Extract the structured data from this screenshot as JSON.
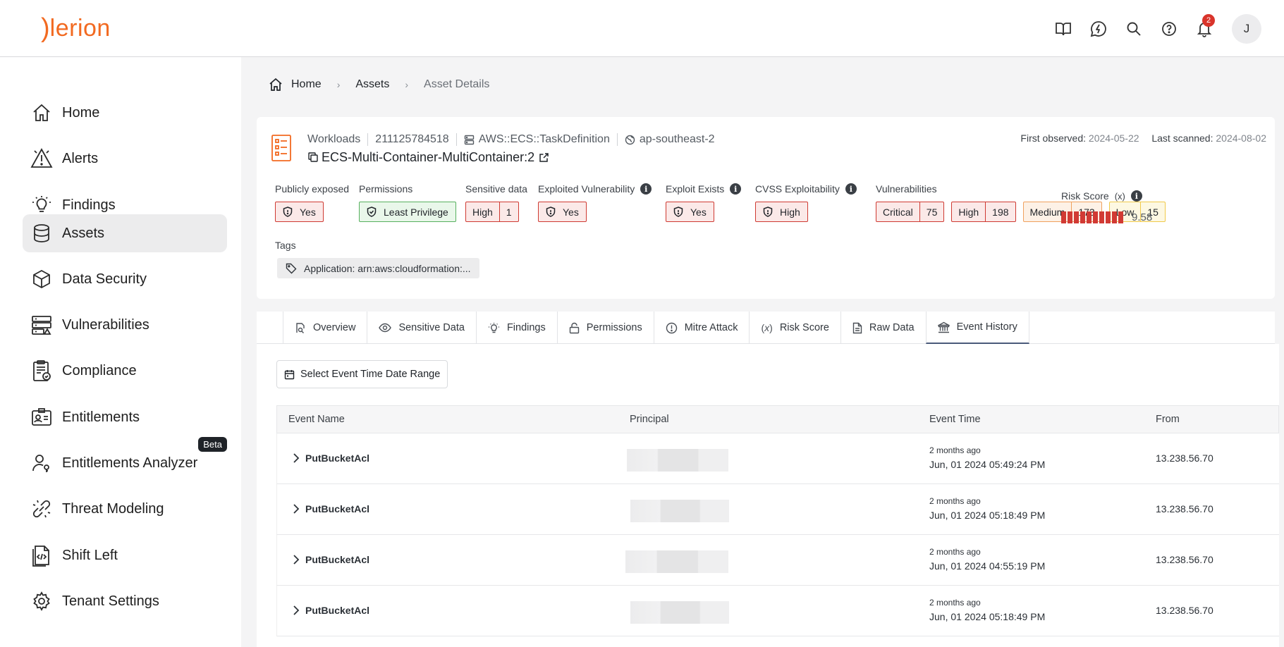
{
  "brand": {
    "logo_mark": ")",
    "logo_text": "lerion",
    "accent": "#f26a21"
  },
  "header": {
    "notification_count": "2",
    "avatar_initial": "J"
  },
  "sidebar": {
    "items": [
      {
        "label": "Home",
        "icon": "home-icon"
      },
      {
        "label": "Alerts",
        "icon": "alert-icon"
      },
      {
        "label": "Findings",
        "icon": "lightbulb-icon"
      },
      {
        "label": "Assets",
        "icon": "database-icon",
        "active": true
      },
      {
        "label": "Data Security",
        "icon": "cube-icon"
      },
      {
        "label": "Vulnerabilities",
        "icon": "server-icon"
      },
      {
        "label": "Compliance",
        "icon": "clipboard-icon"
      },
      {
        "label": "Entitlements",
        "icon": "id-card-icon"
      },
      {
        "label": "Entitlements Analyzer",
        "icon": "user-key-icon",
        "badge": "Beta"
      },
      {
        "label": "Threat Modeling",
        "icon": "link-icon"
      },
      {
        "label": "Shift Left",
        "icon": "code-file-icon"
      },
      {
        "label": "Tenant Settings",
        "icon": "gear-icon"
      }
    ]
  },
  "breadcrumb": {
    "home": "Home",
    "assets": "Assets",
    "current": "Asset Details"
  },
  "asset": {
    "category": "Workloads",
    "account_id": "211125784518",
    "resource_type": "AWS::ECS::TaskDefinition",
    "region": "ap-southeast-2",
    "name": "ECS-Multi-Container-MultiContainer:2",
    "first_observed_label": "First observed:",
    "first_observed": "2024-05-22",
    "last_scanned_label": "Last scanned:",
    "last_scanned": "2024-08-02"
  },
  "facets": {
    "publicly_exposed": {
      "label": "Publicly exposed",
      "value": "Yes"
    },
    "permissions": {
      "label": "Permissions",
      "value": "Least Privilege"
    },
    "sensitive_data": {
      "label": "Sensitive data",
      "level": "High",
      "count": "1"
    },
    "exploited_vulnerability": {
      "label": "Exploited Vulnerability",
      "value": "Yes"
    },
    "exploit_exists": {
      "label": "Exploit Exists",
      "value": "Yes"
    },
    "cvss_exploitability": {
      "label": "CVSS Exploitability",
      "value": "High"
    },
    "vulnerabilities": {
      "label": "Vulnerabilities",
      "critical": {
        "label": "Critical",
        "count": "75"
      },
      "high": {
        "label": "High",
        "count": "198"
      },
      "medium": {
        "label": "Medium",
        "count": "173"
      },
      "low": {
        "label": "Low",
        "count": "15"
      }
    },
    "risk_score": {
      "label": "Risk Score",
      "formula_symbol": "(x)",
      "value": "9.58",
      "level": 0.958
    }
  },
  "tags": {
    "label": "Tags",
    "items": [
      "Application: arn:aws:cloudformation:..."
    ]
  },
  "tabs": [
    {
      "label": "Overview",
      "icon": "doc-search-icon"
    },
    {
      "label": "Sensitive Data",
      "icon": "eye-icon"
    },
    {
      "label": "Findings",
      "icon": "lightbulb-icon"
    },
    {
      "label": "Permissions",
      "icon": "lock-icon"
    },
    {
      "label": "Mitre Attack",
      "icon": "alert-circle-icon"
    },
    {
      "label": "Risk Score",
      "icon": "formula-icon"
    },
    {
      "label": "Raw Data",
      "icon": "file-icon"
    },
    {
      "label": "Event History",
      "icon": "bank-icon",
      "active": true
    }
  ],
  "event_history": {
    "date_range_button": "Select Event Time Date Range",
    "columns": {
      "event_name": "Event Name",
      "principal": "Principal",
      "event_time": "Event Time",
      "from": "From"
    },
    "rows": [
      {
        "event_name": "PutBucketAcl",
        "relative": "2 months ago",
        "time": "Jun, 01 2024 05:49:24 PM",
        "from": "13.238.56.70"
      },
      {
        "event_name": "PutBucketAcl",
        "relative": "2 months ago",
        "time": "Jun, 01 2024 05:18:49 PM",
        "from": "13.238.56.70"
      },
      {
        "event_name": "PutBucketAcl",
        "relative": "2 months ago",
        "time": "Jun, 01 2024 04:55:19 PM",
        "from": "13.238.56.70"
      },
      {
        "event_name": "PutBucketAcl",
        "relative": "2 months ago",
        "time": "Jun, 01 2024 05:18:49 PM",
        "from": "13.238.56.70"
      }
    ]
  }
}
